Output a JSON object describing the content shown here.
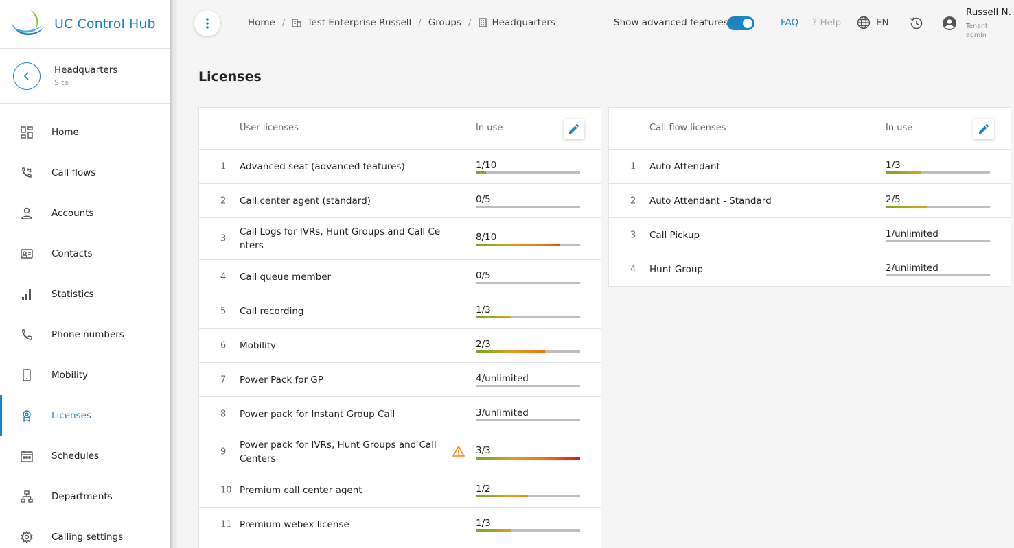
{
  "brand": {
    "name": "UC Control Hub"
  },
  "site": {
    "name": "Headquarters",
    "type": "Site"
  },
  "nav": [
    {
      "label": "Home",
      "icon": "dashboard-icon"
    },
    {
      "label": "Call flows",
      "icon": "call-flows-icon"
    },
    {
      "label": "Accounts",
      "icon": "person-icon"
    },
    {
      "label": "Contacts",
      "icon": "contact-card-icon"
    },
    {
      "label": "Statistics",
      "icon": "signal-bars-icon"
    },
    {
      "label": "Phone numbers",
      "icon": "phone-icon"
    },
    {
      "label": "Mobility",
      "icon": "mobile-icon"
    },
    {
      "label": "Licenses",
      "icon": "badge-icon",
      "active": true
    },
    {
      "label": "Schedules",
      "icon": "calendar-icon"
    },
    {
      "label": "Departments",
      "icon": "org-chart-icon"
    },
    {
      "label": "Calling settings",
      "icon": "gear-icon"
    }
  ],
  "breadcrumb": [
    "Home",
    "Test Enterprise Russell",
    "Groups",
    "Headquarters"
  ],
  "header": {
    "advanced_label": "Show advanced features",
    "advanced_on": true,
    "faq": "FAQ",
    "help": "? Help",
    "lang": "EN",
    "user_name": "Russell N.",
    "user_role": "Tenant admin"
  },
  "page_title": "Licenses",
  "accent": "#1a84c5",
  "user_licenses": {
    "col_name": "User licenses",
    "col_use": "In use",
    "rows": [
      {
        "n": "1",
        "name": "Advanced seat (advanced features)",
        "usage": "1/10",
        "ratio": 0.1
      },
      {
        "n": "2",
        "name": "Call center agent (standard)",
        "usage": "0/5",
        "ratio": 0
      },
      {
        "n": "3",
        "name": "Call Logs for IVRs, Hunt Groups and Call Centers",
        "usage": "8/10",
        "ratio": 0.8
      },
      {
        "n": "4",
        "name": "Call queue member",
        "usage": "0/5",
        "ratio": 0
      },
      {
        "n": "5",
        "name": "Call recording",
        "usage": "1/3",
        "ratio": 0.333
      },
      {
        "n": "6",
        "name": "Mobility",
        "usage": "2/3",
        "ratio": 0.667
      },
      {
        "n": "7",
        "name": "Power Pack for GP",
        "usage": "4/unlimited",
        "ratio": 0
      },
      {
        "n": "8",
        "name": "Power pack for Instant Group Call",
        "usage": "3/unlimited",
        "ratio": 0
      },
      {
        "n": "9",
        "name": "Power pack for IVRs, Hunt Groups and Call Centers",
        "usage": "3/3",
        "ratio": 1,
        "warning": true
      },
      {
        "n": "10",
        "name": "Premium call center agent",
        "usage": "1/2",
        "ratio": 0.5
      },
      {
        "n": "11",
        "name": "Premium webex license",
        "usage": "1/3",
        "ratio": 0.333
      }
    ]
  },
  "call_flow_licenses": {
    "col_name": "Call flow licenses",
    "col_use": "In use",
    "rows": [
      {
        "n": "1",
        "name": "Auto Attendant",
        "usage": "1/3",
        "ratio": 0.333
      },
      {
        "n": "2",
        "name": "Auto Attendant - Standard",
        "usage": "2/5",
        "ratio": 0.4
      },
      {
        "n": "3",
        "name": "Call Pickup",
        "usage": "1/unlimited",
        "ratio": 0
      },
      {
        "n": "4",
        "name": "Hunt Group",
        "usage": "2/unlimited",
        "ratio": 0
      }
    ]
  }
}
